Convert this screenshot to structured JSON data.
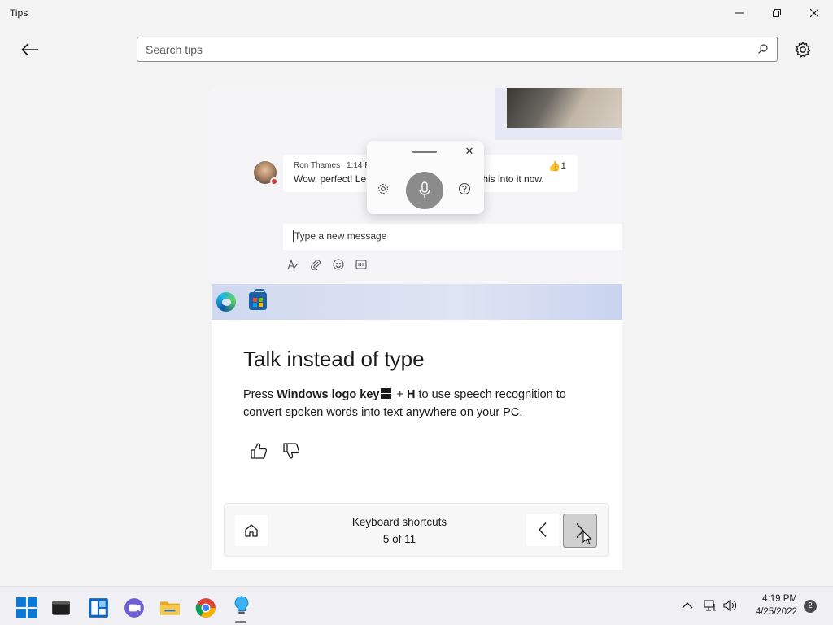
{
  "window": {
    "title": "Tips"
  },
  "search": {
    "placeholder": "Search tips"
  },
  "illustration": {
    "message": {
      "sender": "Ron Thames",
      "time": "1:14 P",
      "text_left": "Wow, perfect! Le",
      "text_right": "rate this into it now.",
      "reaction": "👍1"
    },
    "compose_placeholder": "Type a new message"
  },
  "tip": {
    "title": "Talk instead of type",
    "body_prefix": "Press ",
    "body_key": "Windows logo key",
    "body_plus": " + ",
    "body_h": "H",
    "body_suffix": " to use speech recognition to convert spoken words into text anywhere on your PC."
  },
  "navigation": {
    "category": "Keyboard shortcuts",
    "position": "5 of 11"
  },
  "taskbar": {
    "apps": [
      "start-icon",
      "terminal-icon",
      "widgets-icon",
      "teams-chat-icon",
      "file-explorer-icon",
      "chrome-icon",
      "tips-icon"
    ],
    "clock_time": "4:19 PM",
    "clock_date": "4/25/2022",
    "notification_count": "2"
  }
}
